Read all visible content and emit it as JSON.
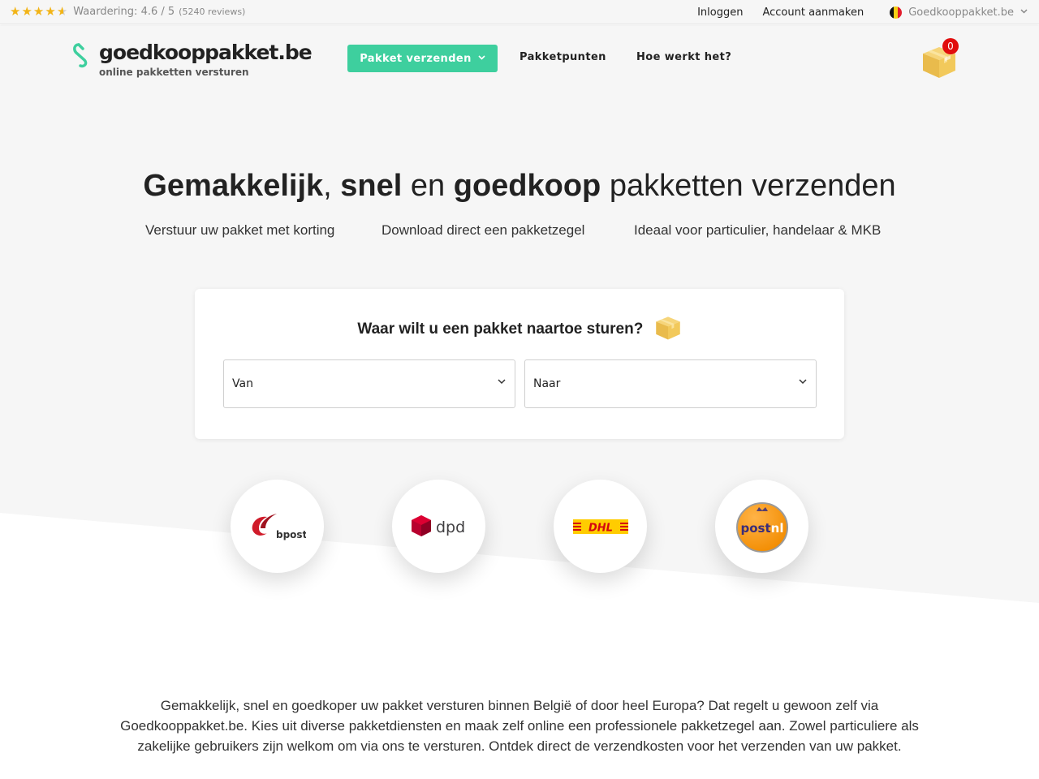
{
  "topbar": {
    "rating_label": "Waardering:",
    "rating_score": "4.6 / 5",
    "rating_reviews": "(5240 reviews)",
    "stars": 4.6,
    "login": "Inloggen",
    "create_account": "Account aanmaken",
    "country_site": "Goedkooppakket.be"
  },
  "header": {
    "logo_name": "goedkooppakket.be",
    "logo_tagline": "online pakketten versturen",
    "nav": {
      "send_parcel": "Pakket verzenden",
      "parcel_points": "Pakketpunten",
      "how_it_works": "Hoe werkt het?"
    },
    "cart_count": "0"
  },
  "hero": {
    "headline_part1": "Gemakkelijk",
    "headline_sep1": ", ",
    "headline_part2": "snel",
    "headline_sep2": " en ",
    "headline_part3": "goedkoop",
    "headline_rest": " pakketten verzenden",
    "usps": [
      "Verstuur uw pakket met korting",
      "Download direct een pakketzegel",
      "Ideaal voor particulier, handelaar & MKB"
    ]
  },
  "form": {
    "title": "Waar wilt u een pakket naartoe sturen?",
    "from_label": "Van",
    "to_label": "Naar"
  },
  "carriers": [
    {
      "name": "bpost"
    },
    {
      "name": "dpd"
    },
    {
      "name": "DHL"
    },
    {
      "name": "postnl"
    }
  ],
  "intro": "Gemakkelijk, snel en goedkoper uw pakket versturen binnen België of door heel Europa? Dat regelt u gewoon zelf via Goedkooppakket.be. Kies uit diverse pakketdiensten en maak zelf online een professionele pakketzegel aan. Zowel particuliere als zakelijke gebruikers zijn welkom om via ons te versturen. Ontdek direct de verzendkosten voor het verzenden van uw pakket.",
  "colors": {
    "accent": "#3ecf9e",
    "badge": "#e10e0e",
    "star": "#f2b417",
    "hero_bg": "#f6f6f6"
  }
}
